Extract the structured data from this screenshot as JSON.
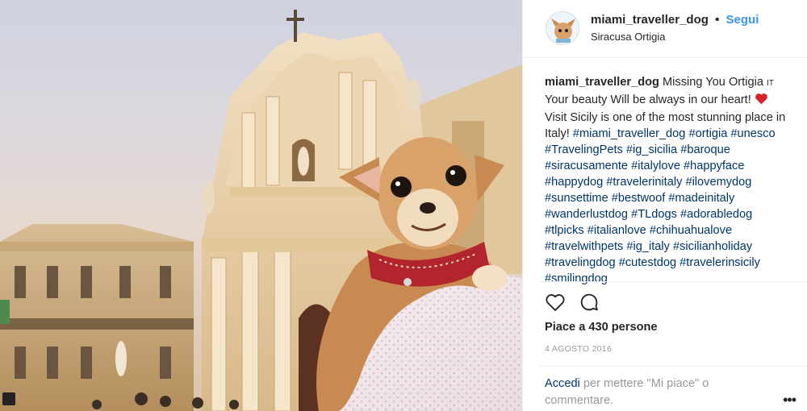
{
  "post": {
    "username": "miami_traveller_dog",
    "separator": "•",
    "follow_label": "Segui",
    "location": "Siracusa Ortigia"
  },
  "caption": {
    "username": "miami_traveller_dog",
    "text_1": "Missing You Ortigia",
    "it_mark": "IT",
    "text_2": "Your beauty Will be always in our heart!",
    "text_3": "Visit Sicily is one of the most stunning place in Italy!",
    "heart_emoji": "❤️",
    "hashtags": [
      "#miami_traveller_dog",
      "#ortigia",
      "#unesco",
      "#TravelingPets",
      "#ig_sicilia",
      "#baroque",
      "#siracusamente",
      "#italylove",
      "#happyface",
      "#happydog",
      "#travelerinitaly",
      "#ilovemydog",
      "#sunsettime",
      "#bestwoof",
      "#madeinitaly",
      "#wanderlustdog",
      "#TLdogs",
      "#adorabledog",
      "#tlpicks",
      "#italianlove",
      "#chihuahualove",
      "#travelwithpets",
      "#ig_italy",
      "#sicilianholiday",
      "#travelingdog",
      "#cutestdog",
      "#travelerinsicily",
      "#smilingdog"
    ]
  },
  "actions": {
    "like_icon": "heart-outline-icon",
    "comment_icon": "comment-bubble-icon",
    "likes_text": "Piace a 430 persone",
    "date": "4 AGOSTO 2016"
  },
  "comment": {
    "login_label": "Accedi",
    "prompt_text": "per mettere \"Mi piace\" o commentare.",
    "more_label": "•••"
  },
  "colors": {
    "follow": "#3897f0",
    "hashtag": "#003569",
    "muted": "#999999",
    "heart": "#ed4956"
  }
}
